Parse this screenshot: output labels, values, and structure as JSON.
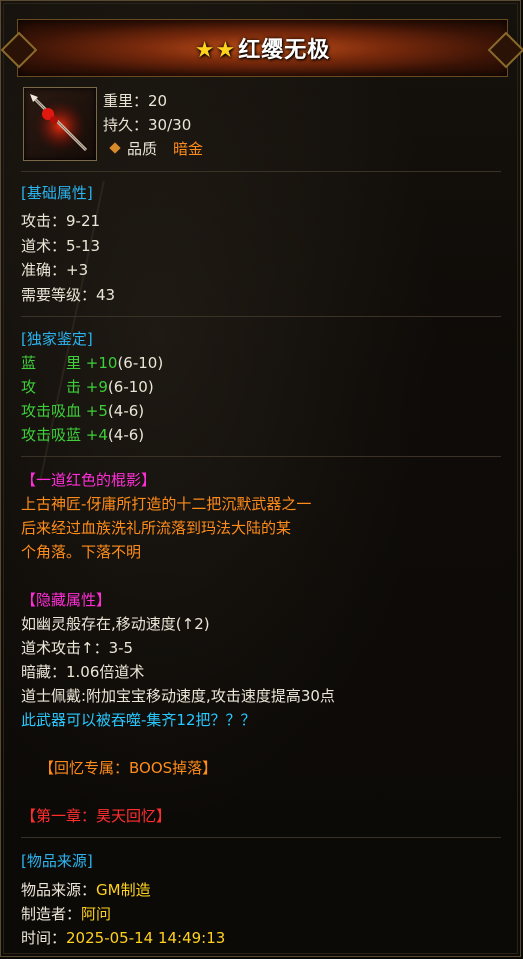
{
  "header": {
    "stars": "★★",
    "title": "红缨无极"
  },
  "item": {
    "weight_label": "重里：",
    "weight_value": "20",
    "durability_label": "持久：",
    "durability_value": "30/30",
    "quality_label": "品质",
    "quality_value": "暗金"
  },
  "basic": {
    "title": "[基础属性]",
    "lines": [
      "攻击：9-21",
      "道术：5-13",
      "准确：+3",
      "需要等级：43"
    ]
  },
  "exclusive": {
    "title": "[独家鉴定]",
    "lines": [
      {
        "name": "蓝　　里",
        "bonus": "+10",
        "range": "(6-10)"
      },
      {
        "name": "攻　　击",
        "bonus": "+9",
        "range": "(6-10)"
      },
      {
        "name": "攻击吸血",
        "bonus": "+5",
        "range": "(4-6)"
      },
      {
        "name": "攻击吸蓝",
        "bonus": "+4",
        "range": "(4-6)"
      }
    ]
  },
  "lore": {
    "title": "【一道红色的棍影】",
    "lines": [
      "上古神匠-伢庸所打造的十二把沉默武器之一",
      "后来经过血族洗礼所流落到玛法大陆的某",
      "个角落。下落不明"
    ]
  },
  "hidden": {
    "title": "【隐藏属性】",
    "lines": [
      "如幽灵般存在,移动速度(↑2)",
      "道术攻击↑：3-5",
      "暗藏：1.06倍道术",
      "道士佩戴:附加宝宝移动速度,攻击速度提高30点"
    ],
    "devour": "此武器可以被吞噬-集齐12把？？？"
  },
  "memory": {
    "label": "【回忆专属：BOOS掉落】"
  },
  "chapter": {
    "label": "【第一章：昊天回忆】"
  },
  "source": {
    "title": "[物品来源]",
    "origin_label": "物品来源：",
    "origin_value": "GM制造",
    "maker_label": "制造者：",
    "maker_value": "阿问",
    "time_label": "时间：",
    "time_value": "2025-05-14 14:49:13"
  },
  "colors": {
    "section": "#2ab4f0",
    "green": "#3ecf3a",
    "orange": "#ff8c1a",
    "magenta": "#ff2ed6",
    "red": "#ff2e2e",
    "star": "#ffd21e"
  },
  "icons": [
    "weapon-spear-icon",
    "quality-diamond-icon",
    "star-icon"
  ]
}
